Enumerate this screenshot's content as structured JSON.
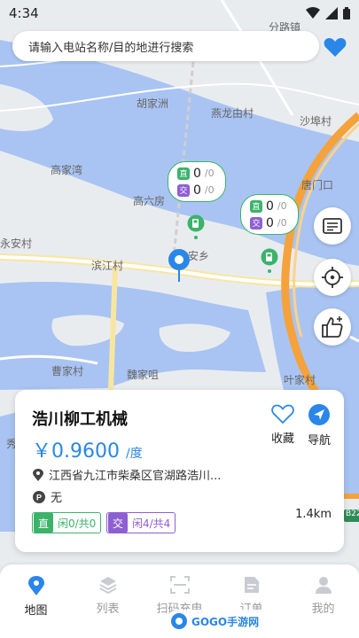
{
  "status_bar": {
    "time": "4:34"
  },
  "search": {
    "placeholder": "请输入电站名称/目的地进行搜索"
  },
  "map": {
    "labels": [
      "分路镇",
      "胡家洲",
      "燕龙由村",
      "沙埠村",
      "高家湾",
      "高六房",
      "唐门口",
      "永安村",
      "安乡",
      "滨江村",
      "曹家村",
      "魏家咀",
      "叶家村",
      "秀"
    ],
    "bubbles": [
      {
        "dc_free": "0",
        "dc_total": "/0",
        "ac_free": "0",
        "ac_total": "/0"
      },
      {
        "dc_free": "0",
        "dc_total": "/0",
        "ac_free": "0",
        "ac_total": "/0"
      }
    ],
    "road_badge": "B22",
    "colors": {
      "water": "#a9c4f2",
      "land": "#e9ecef",
      "highway": "#f5a23c",
      "station": "#3bb36b",
      "accent": "#2a86e8"
    }
  },
  "side_buttons": [
    "message-icon",
    "locate-icon",
    "thumbs-up-icon"
  ],
  "card": {
    "name": "浩川柳工机械",
    "price": "￥0.9600",
    "price_unit": "/度",
    "favorite_label": "收藏",
    "navigate_label": "导航",
    "address": "江西省九江市柴桑区官湖路浩川...",
    "parking": "无",
    "dc": {
      "tag": "直",
      "text": "闲0/共0"
    },
    "ac": {
      "tag": "交",
      "text": "闲4/共4"
    },
    "distance": "1.4km"
  },
  "tabs": [
    {
      "label": "地图",
      "icon": "map-pin-icon",
      "active": true
    },
    {
      "label": "列表",
      "icon": "layers-icon",
      "active": false
    },
    {
      "label": "扫码充电",
      "icon": "scan-icon",
      "active": false
    },
    {
      "label": "订单",
      "icon": "document-icon",
      "active": false
    },
    {
      "label": "我的",
      "icon": "person-icon",
      "active": false
    }
  ],
  "bubble_tags": {
    "dc": "直",
    "ac": "交"
  },
  "watermark": {
    "text": "GOGO手游网"
  }
}
